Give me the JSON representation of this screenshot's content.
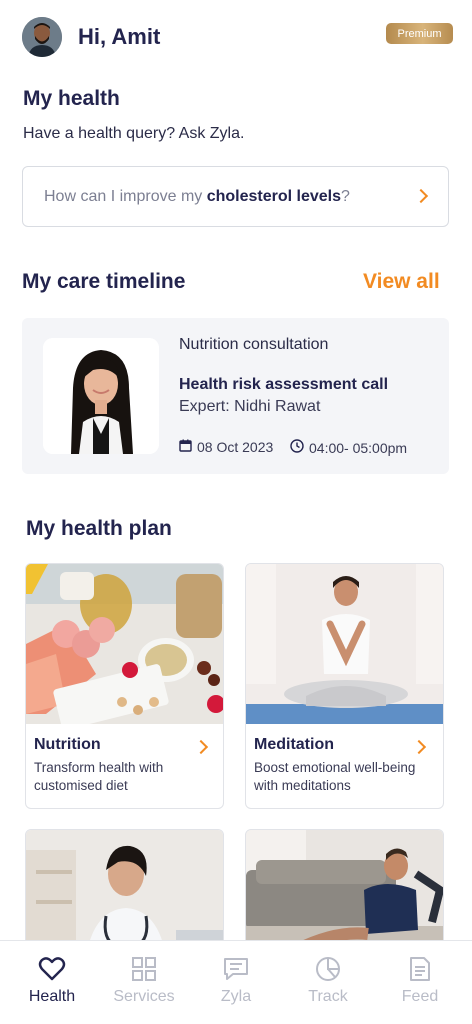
{
  "header": {
    "greeting": "Hi, Amit",
    "badge": "Premium"
  },
  "my_health": {
    "title": "My health",
    "subtitle": "Have a health query? Ask Zyla.",
    "query_prefix": "How can I improve my ",
    "query_bold": "cholesterol levels",
    "query_suffix": "?"
  },
  "care_timeline": {
    "title": "My care timeline",
    "view_all": "View all",
    "card": {
      "type": "Nutrition consultation",
      "title": "Health risk assessment call",
      "expert": "Expert: Nidhi Rawat",
      "date": "08 Oct 2023",
      "time": "04:00- 05:00pm"
    }
  },
  "health_plan": {
    "title": "My health plan",
    "items": [
      {
        "title": "Nutrition",
        "desc": "Transform health with customised diet"
      },
      {
        "title": "Meditation",
        "desc": "Boost emotional well-being with meditations"
      }
    ]
  },
  "nav": {
    "items": [
      {
        "label": "Health",
        "icon": "heart-icon",
        "active": true
      },
      {
        "label": "Services",
        "icon": "grid-icon"
      },
      {
        "label": "Zyla",
        "icon": "chat-icon"
      },
      {
        "label": "Track",
        "icon": "pie-chart-icon"
      },
      {
        "label": "Feed",
        "icon": "document-icon"
      }
    ]
  },
  "colors": {
    "primary_text": "#23244e",
    "accent": "#f28b22",
    "premium_gold": "#c9a165",
    "inactive_nav": "#b9bcc7"
  }
}
